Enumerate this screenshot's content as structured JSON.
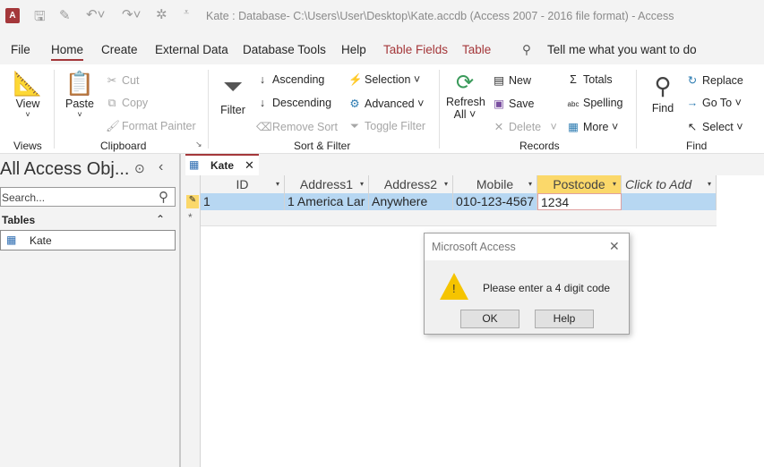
{
  "titlebar": {
    "title": "Kate : Database- C:\\Users\\User\\Desktop\\Kate.accdb (Access 2007 - 2016 file format)  -  Access",
    "app_icon": "A"
  },
  "menu": {
    "tabs": [
      "File",
      "Home",
      "Create",
      "External Data",
      "Database Tools",
      "Help",
      "Table Fields",
      "Table"
    ],
    "tell_me": "Tell me what you want to do"
  },
  "ribbon": {
    "views": {
      "view": "View",
      "group": "Views"
    },
    "clipboard": {
      "paste": "Paste",
      "cut": "Cut",
      "copy": "Copy",
      "format_painter": "Format Painter",
      "group": "Clipboard"
    },
    "sort_filter": {
      "filter": "Filter",
      "ascending": "Ascending",
      "descending": "Descending",
      "remove_sort": "Remove Sort",
      "selection": "Selection",
      "advanced": "Advanced",
      "toggle_filter": "Toggle Filter",
      "group": "Sort & Filter"
    },
    "records": {
      "refresh": "Refresh",
      "all": "All",
      "new": "New",
      "save": "Save",
      "delete": "Delete",
      "totals": "Totals",
      "spelling": "Spelling",
      "more": "More",
      "group": "Records"
    },
    "find": {
      "find": "Find",
      "replace": "Replace",
      "goto": "Go To",
      "select": "Select",
      "group": "Find"
    }
  },
  "nav": {
    "title": "All Access Obj...",
    "search_placeholder": "Search...",
    "section": "Tables",
    "items": [
      "Kate"
    ]
  },
  "doc_tab": {
    "label": "Kate"
  },
  "table": {
    "columns": [
      "ID",
      "Address1",
      "Address2",
      "Mobile",
      "Postcode",
      "Click to Add"
    ],
    "rows": [
      [
        "1",
        "1 America Lar",
        "Anywhere",
        "010-123-4567",
        "1234",
        ""
      ]
    ]
  },
  "dialog": {
    "title": "Microsoft Access",
    "message": "Please enter a 4 digit code",
    "ok": "OK",
    "help": "Help"
  }
}
